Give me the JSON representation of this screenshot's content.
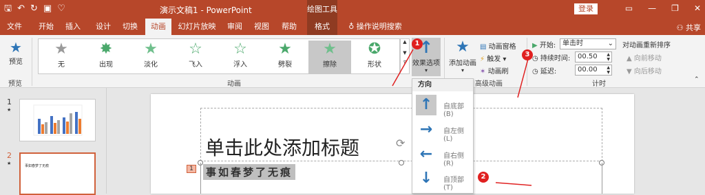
{
  "titlebar": {
    "title": "演示文稿1  -  PowerPoint",
    "context_tab": "绘图工具",
    "login": "登录"
  },
  "tabs": [
    "文件",
    "开始",
    "插入",
    "设计",
    "切换",
    "动画",
    "幻灯片放映",
    "审阅",
    "视图",
    "帮助",
    "格式"
  ],
  "tell_me": "操作说明搜索",
  "share": "共享",
  "preview": {
    "label": "预览",
    "group": "预览"
  },
  "animations": [
    "无",
    "出现",
    "淡化",
    "飞入",
    "浮入",
    "劈裂",
    "擦除",
    "形状"
  ],
  "selected_animation": "擦除",
  "effect_options": {
    "line1": "效果选项",
    "line2": "▾"
  },
  "animations_group": "动画",
  "add_animation": {
    "line1": "添加动画",
    "line2": "▾"
  },
  "advanced": {
    "pane": "动画窗格",
    "trigger": "触发 ▾",
    "painter": "动画刷",
    "group": "高级动画"
  },
  "timing": {
    "start_label": "开始:",
    "start_value": "单击时",
    "duration_label": "持续时间:",
    "duration_value": "00.50",
    "delay_label": "延迟:",
    "delay_value": "00.00",
    "group": "计时"
  },
  "reorder": {
    "title": "对动画重新排序",
    "earlier": "▲ 向前移动",
    "later": "▼ 向后移动"
  },
  "slides": [
    {
      "num": "1",
      "star": "★"
    },
    {
      "num": "2",
      "star": "★"
    }
  ],
  "slide2_thumb_text": "事如春梦了无痕",
  "slide": {
    "title_placeholder": "单击此处添加标题",
    "anim_tag": "1",
    "body_text": "事如春梦了无痕"
  },
  "dropdown": {
    "header": "方向",
    "items": [
      {
        "label": "自底部(B)",
        "arrow": "↑"
      },
      {
        "label": "自左侧(L)",
        "arrow": "→"
      },
      {
        "label": "自右侧(R)",
        "arrow": "←"
      },
      {
        "label": "自顶部(T)",
        "arrow": "↓"
      }
    ]
  },
  "badges": [
    "1",
    "2",
    "3"
  ],
  "colors": {
    "brand": "#b7472a",
    "accent_blue": "#2e75b6",
    "badge_red": "#e02020"
  }
}
